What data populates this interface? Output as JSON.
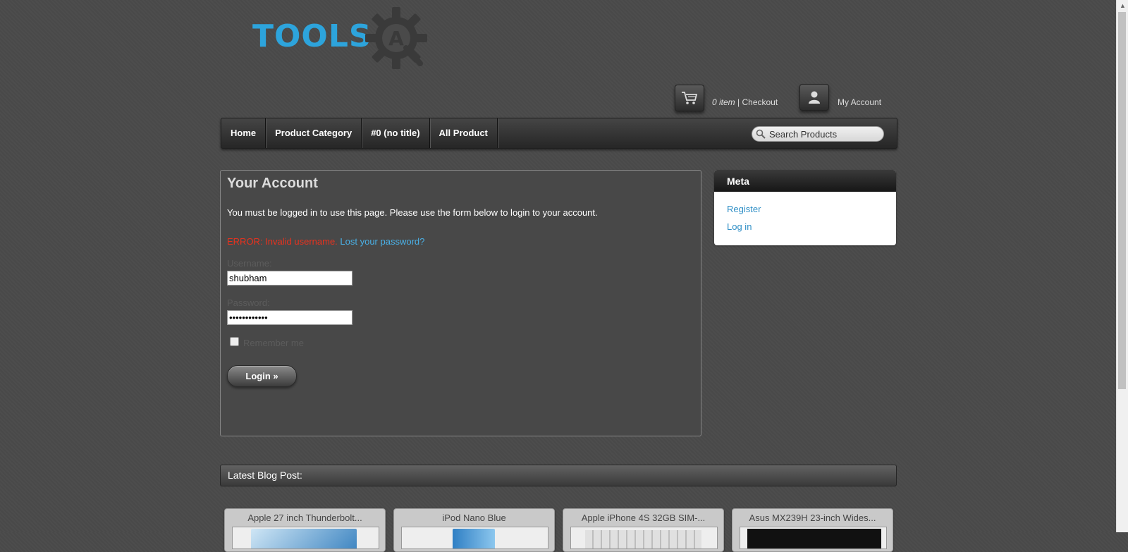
{
  "logo": {
    "text": "TOOLS",
    "gear_letter": "A"
  },
  "header": {
    "cart_count": "0 item",
    "cart_separator": " | ",
    "checkout_label": "Checkout",
    "my_account_label": "My Account"
  },
  "nav": {
    "items": [
      {
        "label": "Home"
      },
      {
        "label": "Product Category"
      },
      {
        "label": "#0 (no title)"
      },
      {
        "label": "All Product"
      }
    ],
    "search_placeholder": "Search Products"
  },
  "account": {
    "title": "Your Account",
    "notice": "You must be logged in to use this page. Please use the form below to login to your account.",
    "error": "ERROR: Invalid username.",
    "lost_password": "Lost your password?",
    "username_label": "Username:",
    "username_value": "shubham",
    "password_label": "Password:",
    "password_value": "••••••••••••",
    "remember_label": "Remember me",
    "login_button": "Login »"
  },
  "meta": {
    "title": "Meta",
    "links": [
      {
        "label": "Register"
      },
      {
        "label": "Log in"
      }
    ]
  },
  "blog": {
    "title": "Latest Blog Post:"
  },
  "products": [
    {
      "title": "Apple 27 inch Thunderbolt..."
    },
    {
      "title": "iPod Nano Blue"
    },
    {
      "title": "Apple iPhone 4S 32GB SIM-..."
    },
    {
      "title": "Asus MX239H 23-inch Wides..."
    }
  ],
  "colors": {
    "accent": "#2da4dc",
    "error": "#e8321e",
    "link": "#4ab0e6",
    "background": "#4a4a4a"
  }
}
